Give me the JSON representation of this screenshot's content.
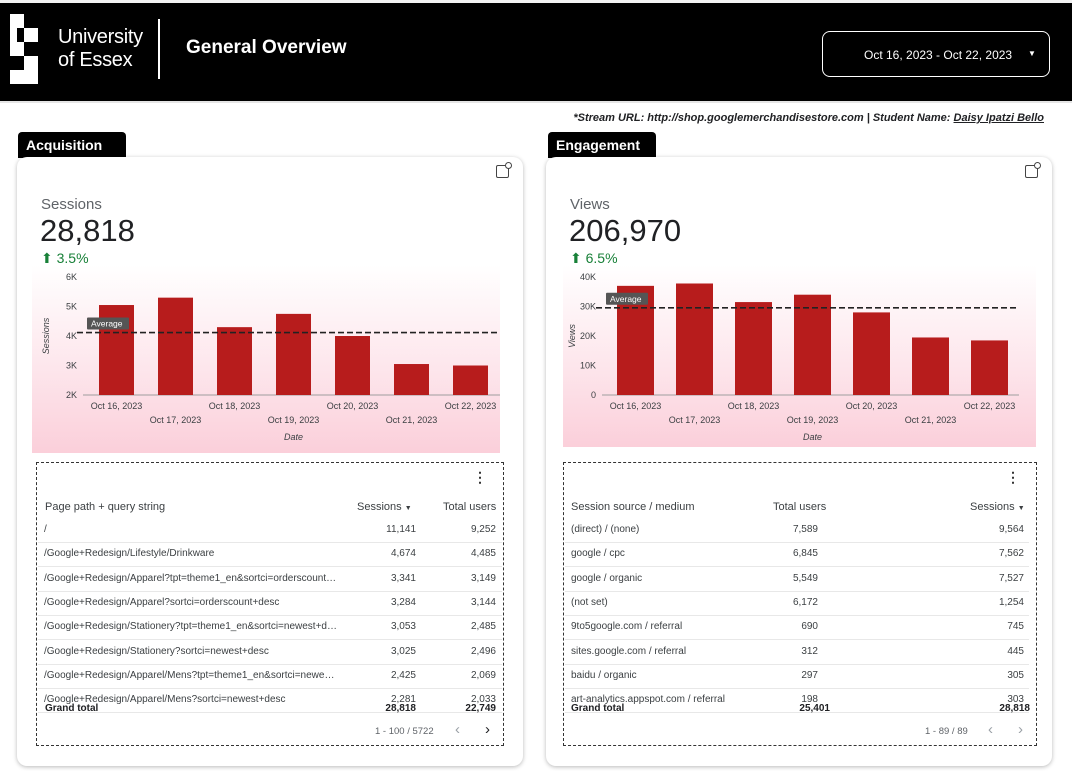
{
  "header": {
    "logo_line1": "University",
    "logo_line2": "of Essex",
    "title": "General Overview",
    "date_range": "Oct 16, 2023 - Oct 22, 2023"
  },
  "stream": {
    "prefix": "*Stream URL: http://shop.googlemerchandisestore.com | Student Name: ",
    "student": "Daisy Ipatzi Bello"
  },
  "colors": {
    "bar": "#b71c1c",
    "positive": "#188038"
  },
  "acquisition": {
    "tab": "Acquisition",
    "metric_label": "Sessions",
    "metric_value": "28,818",
    "delta": "3.5%",
    "chart_data": {
      "type": "bar",
      "categories": [
        "Oct 16, 2023",
        "Oct 17, 2023",
        "Oct 18, 2023",
        "Oct 19, 2023",
        "Oct 20, 2023",
        "Oct 21, 2023",
        "Oct 22, 2023"
      ],
      "values": [
        5050,
        5300,
        4300,
        4750,
        4000,
        3050,
        3000
      ],
      "average": 4117,
      "average_label": "Average",
      "ylabel": "Sessions",
      "xlabel": "Date",
      "ylim": [
        2000,
        6000
      ],
      "yticks": [
        2000,
        3000,
        4000,
        5000,
        6000
      ],
      "ytick_labels": [
        "2K",
        "3K",
        "4K",
        "5K",
        "6K"
      ]
    },
    "table": {
      "headers": [
        "Page path + query string",
        "Sessions",
        "Total users"
      ],
      "rows": [
        [
          "/",
          "11,141",
          "9,252"
        ],
        [
          "/Google+Redesign/Lifestyle/Drinkware",
          "4,674",
          "4,485"
        ],
        [
          "/Google+Redesign/Apparel?tpt=theme1_en&sortci=orderscount…",
          "3,341",
          "3,149"
        ],
        [
          "/Google+Redesign/Apparel?sortci=orderscount+desc",
          "3,284",
          "3,144"
        ],
        [
          "/Google+Redesign/Stationery?tpt=theme1_en&sortci=newest+d…",
          "3,053",
          "2,485"
        ],
        [
          "/Google+Redesign/Stationery?sortci=newest+desc",
          "3,025",
          "2,496"
        ],
        [
          "/Google+Redesign/Apparel/Mens?tpt=theme1_en&sortci=newe…",
          "2,425",
          "2,069"
        ],
        [
          "/Google+Redesign/Apparel/Mens?sortci=newest+desc",
          "2,281",
          "2,033"
        ]
      ],
      "total_label": "Grand total",
      "totals": [
        "28,818",
        "22,749"
      ],
      "pager": "1 - 100 / 5722"
    }
  },
  "engagement": {
    "tab": "Engagement",
    "metric_label": "Views",
    "metric_value": "206,970",
    "delta": "6.5%",
    "chart_data": {
      "type": "bar",
      "categories": [
        "Oct 16, 2023",
        "Oct 17, 2023",
        "Oct 18, 2023",
        "Oct 19, 2023",
        "Oct 20, 2023",
        "Oct 21, 2023",
        "Oct 22, 2023"
      ],
      "values": [
        37000,
        37800,
        31500,
        34000,
        28000,
        19500,
        18500
      ],
      "average": 29567,
      "average_label": "Average",
      "ylabel": "Views",
      "xlabel": "Date",
      "ylim": [
        0,
        40000
      ],
      "yticks": [
        0,
        10000,
        20000,
        30000,
        40000
      ],
      "ytick_labels": [
        "0",
        "10K",
        "20K",
        "30K",
        "40K"
      ]
    },
    "table": {
      "headers": [
        "Session source / medium",
        "Total users",
        "Sessions"
      ],
      "rows": [
        [
          "(direct) / (none)",
          "7,589",
          "9,564"
        ],
        [
          "google / cpc",
          "6,845",
          "7,562"
        ],
        [
          "google / organic",
          "5,549",
          "7,527"
        ],
        [
          "(not set)",
          "6,172",
          "1,254"
        ],
        [
          "9to5google.com / referral",
          "690",
          "745"
        ],
        [
          "sites.google.com / referral",
          "312",
          "445"
        ],
        [
          "baidu / organic",
          "297",
          "305"
        ],
        [
          "art-analytics.appspot.com / referral",
          "198",
          "303"
        ]
      ],
      "total_label": "Grand total",
      "totals": [
        "25,401",
        "28,818"
      ],
      "pager": "1 - 89 / 89"
    }
  }
}
